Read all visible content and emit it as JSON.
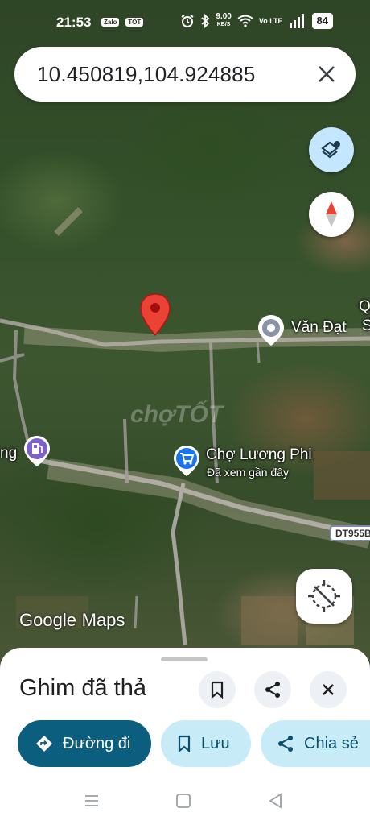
{
  "status_bar": {
    "time": "21:53",
    "app_icon_1": "Zalo",
    "app_icon_2": "TỐT",
    "speed_value": "9.00",
    "speed_unit": "KB/S",
    "network": "Vo LTE",
    "battery": "84"
  },
  "search": {
    "query": "10.450819,104.924885"
  },
  "map": {
    "place_van_dat": "Văn Đạt",
    "place_cho": "Chợ Lương Phi",
    "place_cho_sub": "Đã xem gần đây",
    "place_left_partial": "ng",
    "place_right_partial_1": "Q",
    "place_right_partial_2": "S",
    "road_shield": "DT955B",
    "logo_google": "Google",
    "logo_maps": "Maps",
    "watermark": "chợTỐT"
  },
  "sheet": {
    "title": "Ghim đã thả",
    "directions_label": "Đường đi",
    "save_label": "Lưu",
    "share_label": "Chia sẻ"
  },
  "colors": {
    "primary": "#0b5e7e",
    "secondary": "#c7ecf7",
    "pin": "#ea4335",
    "layers_fab": "#c4e7ff"
  }
}
